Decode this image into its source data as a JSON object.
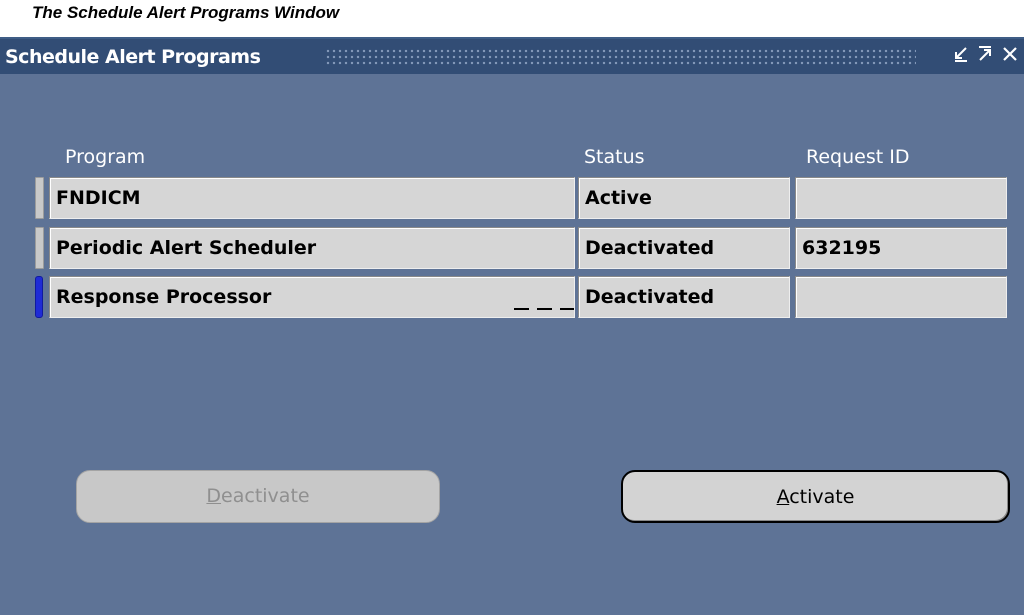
{
  "caption": "The Schedule Alert Programs Window",
  "window": {
    "title": "Schedule Alert Programs",
    "controls": {
      "minimize_icon": "↙",
      "maximize_icon": "↗",
      "close_icon": "×"
    }
  },
  "table": {
    "columns": [
      "Program",
      "Status",
      "Request ID"
    ],
    "rows": [
      {
        "program": "FNDICM",
        "status": "Active",
        "request_id": ""
      },
      {
        "program": "Periodic Alert Scheduler",
        "status": "Deactivated",
        "request_id": "632195"
      },
      {
        "program": "Response Processor",
        "status": "Deactivated",
        "request_id": ""
      }
    ],
    "current_row": 2
  },
  "buttons": {
    "deactivate": {
      "accel": "D",
      "rest": "eactivate",
      "enabled": false
    },
    "activate": {
      "accel": "A",
      "rest": "ctivate",
      "enabled": true
    }
  },
  "colors": {
    "window_bg": "#5e7396",
    "titlebar_bg": "#324d75",
    "row_indicator_active": "#1f2bd6"
  }
}
